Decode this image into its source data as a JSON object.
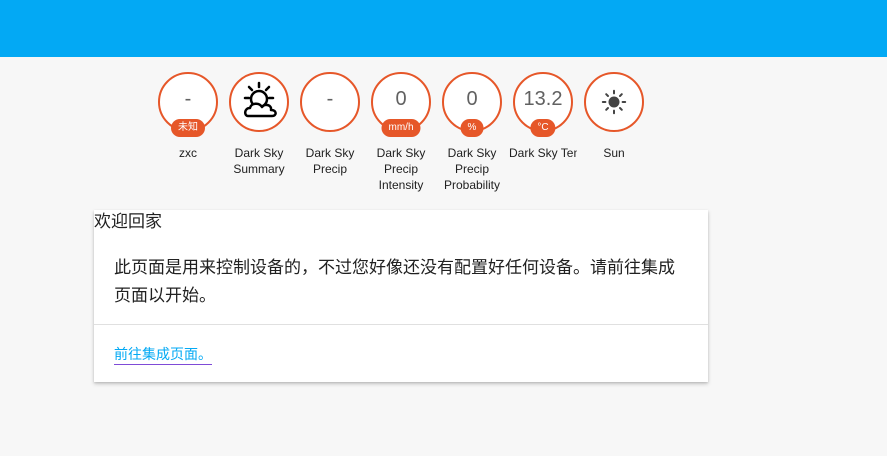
{
  "colors": {
    "header": "#03a9f4",
    "badge_accent": "#e65729",
    "link": "#03a9f4"
  },
  "badges": [
    {
      "value": "-",
      "unit": "未知",
      "label": "zxc",
      "icon": null
    },
    {
      "value": "",
      "unit": "",
      "label": "Dark Sky Summary",
      "icon": "partly-cloudy-icon"
    },
    {
      "value": "-",
      "unit": "",
      "label": "Dark Sky Precip",
      "icon": null
    },
    {
      "value": "0",
      "unit": "mm/h",
      "label": "Dark Sky Precip Intensity",
      "icon": null
    },
    {
      "value": "0",
      "unit": "%",
      "label": "Dark Sky Precip Probability",
      "icon": null
    },
    {
      "value": "13.2",
      "unit": "°C",
      "label": "Dark Sky Temperatur",
      "icon": null
    },
    {
      "value": "",
      "unit": "",
      "label": "Sun",
      "icon": "sun-icon"
    }
  ],
  "card": {
    "title": "欢迎回家",
    "body": "此页面是用来控制设备的，不过您好像还没有配置好任何设备。请前往集成页面以开始。",
    "link_label": "前往集成页面。"
  }
}
